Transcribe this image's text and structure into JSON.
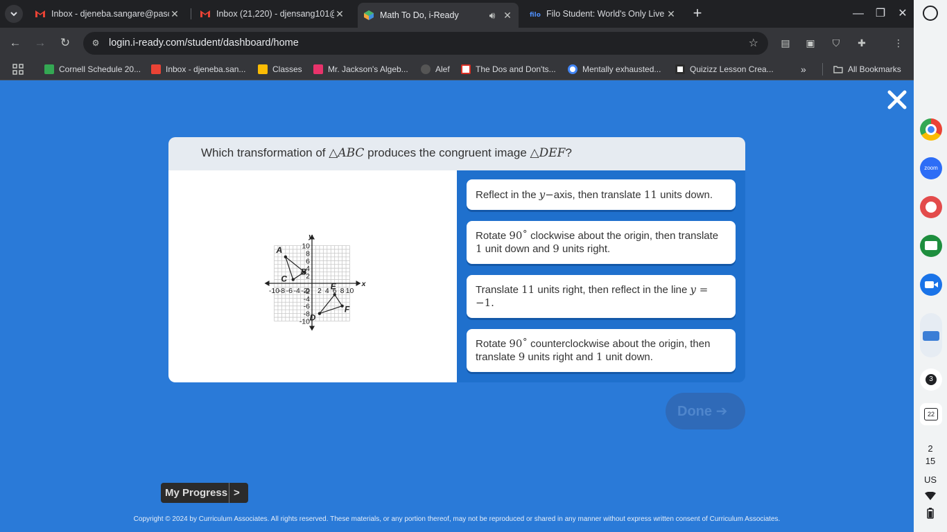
{
  "browser": {
    "tabs": [
      {
        "title": "Inbox - djeneba.sangare@pasc",
        "icon": "gmail-icon"
      },
      {
        "title": "Inbox (21,220) - djensang101@",
        "icon": "gmail-icon"
      },
      {
        "title": "Math To Do, i-Ready",
        "icon": "iready-icon",
        "active": true,
        "audio": true
      },
      {
        "title": "Filo Student: World's Only Live I",
        "icon": "filo-icon"
      }
    ],
    "url": "login.i-ready.com/student/dashboard/home",
    "bookmarks": [
      {
        "label": "Cornell Schedule 20...",
        "color": "#34a853"
      },
      {
        "label": "Inbox - djeneba.san...",
        "color": "#ea4335"
      },
      {
        "label": "Classes",
        "color": "#fbbc04"
      },
      {
        "label": "Mr. Jackson's Algeb...",
        "color": "#e8336b"
      },
      {
        "label": "Alef",
        "color": "#555"
      },
      {
        "label": "The Dos and Don'ts...",
        "color": "#d93025"
      },
      {
        "label": "Mentally exhausted...",
        "color": "#4285f4"
      },
      {
        "label": "Quizizz Lesson Crea...",
        "color": "#6a3fb8"
      }
    ],
    "all_bookmarks": "All Bookmarks"
  },
  "shelf": {
    "notification_count": "3",
    "calendar_day": "22",
    "time_hour": "2",
    "time_minute": "15",
    "locale": "US",
    "icons": [
      "chrome-icon",
      "zoom-icon",
      "palette-icon",
      "classroom-icon",
      "meet-icon",
      "app-icon"
    ]
  },
  "question": {
    "prefix": "Which transformation of ",
    "tri1": "△ABC",
    "middle": " produces the congruent image ",
    "tri2": "△DEF",
    "suffix": "?"
  },
  "graph": {
    "x_label": "x",
    "y_label": "y",
    "x_ticks": [
      "-10",
      "-8",
      "-6",
      "-4",
      "-2",
      "0",
      "2",
      "4",
      "6",
      "8",
      "10"
    ],
    "y_ticks": [
      "10",
      "8",
      "6",
      "4",
      "2",
      "-2",
      "-4",
      "-6",
      "-8",
      "-10"
    ],
    "range": [
      -10,
      10
    ],
    "points": [
      {
        "label": "A",
        "x": -7,
        "y": 7
      },
      {
        "label": "B",
        "x": -2,
        "y": 3
      },
      {
        "label": "C",
        "x": -5,
        "y": 1
      },
      {
        "label": "D",
        "x": 2,
        "y": -8
      },
      {
        "label": "E",
        "x": 6,
        "y": -3
      },
      {
        "label": "F",
        "x": 8,
        "y": -6
      }
    ]
  },
  "choices": [
    {
      "parts": [
        [
          "t",
          "Reflect in the "
        ],
        [
          "mi",
          "y"
        ],
        [
          "m",
          "−"
        ],
        [
          "t",
          "axis, then translate "
        ],
        [
          "m",
          "11"
        ],
        [
          "t",
          " units down."
        ]
      ]
    },
    {
      "parts": [
        [
          "t",
          "Rotate "
        ],
        [
          "m",
          "90˚"
        ],
        [
          "t",
          " clockwise about the origin, then translate "
        ],
        [
          "m",
          "1"
        ],
        [
          "t",
          " unit down and "
        ],
        [
          "m",
          "9"
        ],
        [
          "t",
          " units right."
        ]
      ]
    },
    {
      "parts": [
        [
          "t",
          "Translate "
        ],
        [
          "m",
          "11"
        ],
        [
          "t",
          " units right, then reflect in the line "
        ],
        [
          "mi",
          "y"
        ],
        [
          "m",
          " = −1."
        ]
      ]
    },
    {
      "parts": [
        [
          "t",
          "Rotate "
        ],
        [
          "m",
          "90˚"
        ],
        [
          "t",
          " counterclockwise about the origin, then translate "
        ],
        [
          "m",
          "9"
        ],
        [
          "t",
          " units right and "
        ],
        [
          "m",
          "1"
        ],
        [
          "t",
          " unit down."
        ]
      ]
    }
  ],
  "done_label": "Done",
  "progress": {
    "label": "My Progress",
    "arrow": ">"
  },
  "copyright": "Copyright © 2024 by Curriculum Associates. All rights reserved. These materials, or any portion thereof, may not be reproduced or shared in any manner without express written consent of Curriculum Associates."
}
